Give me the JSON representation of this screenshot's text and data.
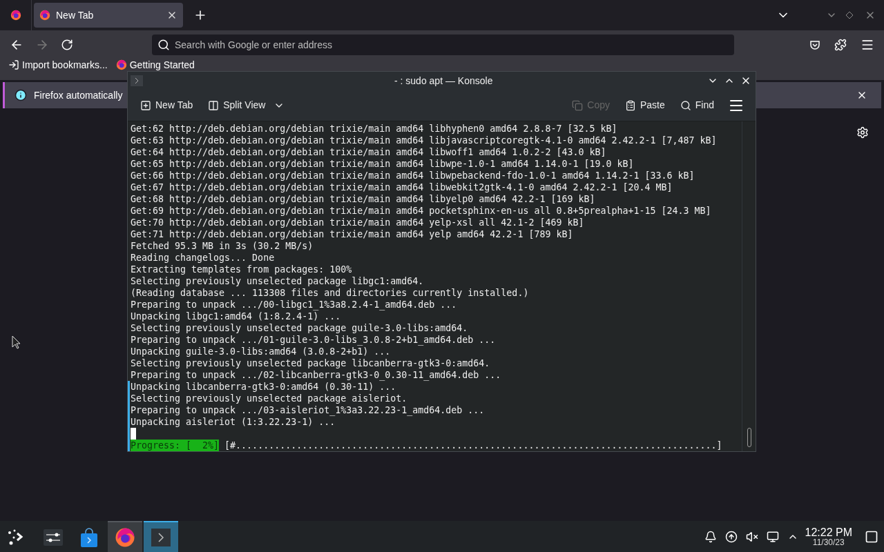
{
  "firefox": {
    "tabs": [
      {
        "title": "New Tab",
        "selected": true
      }
    ],
    "address_bar": {
      "placeholder": "Search with Google or enter address"
    },
    "forward_disabled": true,
    "bookmarks": [
      "Import bookmarks...",
      "Getting Started"
    ],
    "notification": {
      "text": "Firefox automatically"
    }
  },
  "konsole": {
    "title": "- : sudo apt — Konsole",
    "toolbar": [
      {
        "label": "New Tab",
        "kind": "new-tab",
        "disabled": false
      },
      {
        "label": "Split View",
        "kind": "split",
        "disabled": false
      }
    ],
    "actions": [
      {
        "label": "Copy",
        "kind": "copy",
        "disabled": true
      },
      {
        "label": "Paste",
        "kind": "paste",
        "disabled": false
      },
      {
        "label": "Find",
        "kind": "find",
        "disabled": false
      }
    ],
    "lines": [
      {
        "text": "Get:62 http://deb.debian.org/debian trixie/main amd64 libhyphen0 amd64 2.8.8-7 [32.5 kB]",
        "marked": false
      },
      {
        "text": "Get:63 http://deb.debian.org/debian trixie/main amd64 libjavascriptcoregtk-4.1-0 amd64 2.42.2-1 [7,487 kB]",
        "marked": false
      },
      {
        "text": "Get:64 http://deb.debian.org/debian trixie/main amd64 libwoff1 amd64 1.0.2-2 [43.0 kB]",
        "marked": false
      },
      {
        "text": "Get:65 http://deb.debian.org/debian trixie/main amd64 libwpe-1.0-1 amd64 1.14.0-1 [19.0 kB]",
        "marked": false
      },
      {
        "text": "Get:66 http://deb.debian.org/debian trixie/main amd64 libwpebackend-fdo-1.0-1 amd64 1.14.2-1 [33.6 kB]",
        "marked": false
      },
      {
        "text": "Get:67 http://deb.debian.org/debian trixie/main amd64 libwebkit2gtk-4.1-0 amd64 2.42.2-1 [20.4 MB]",
        "marked": false
      },
      {
        "text": "Get:68 http://deb.debian.org/debian trixie/main amd64 libyelp0 amd64 42.2-1 [169 kB]",
        "marked": false
      },
      {
        "text": "Get:69 http://deb.debian.org/debian trixie/main amd64 pocketsphinx-en-us all 0.8+5prealpha+1-15 [24.3 MB]",
        "marked": false
      },
      {
        "text": "Get:70 http://deb.debian.org/debian trixie/main amd64 yelp-xsl all 42.1-2 [469 kB]",
        "marked": false
      },
      {
        "text": "Get:71 http://deb.debian.org/debian trixie/main amd64 yelp amd64 42.2-1 [789 kB]",
        "marked": false
      },
      {
        "text": "Fetched 95.3 MB in 3s (30.2 MB/s)",
        "marked": false
      },
      {
        "text": "Reading changelogs... Done",
        "marked": false
      },
      {
        "text": "Extracting templates from packages: 100%",
        "marked": false
      },
      {
        "text": "Selecting previously unselected package libgc1:amd64.",
        "marked": false
      },
      {
        "text": "(Reading database ... 113308 files and directories currently installed.)",
        "marked": false
      },
      {
        "text": "Preparing to unpack .../00-libgc1_1%3a8.2.4-1_amd64.deb ...",
        "marked": false
      },
      {
        "text": "Unpacking libgc1:amd64 (1:8.2.4-1) ...",
        "marked": false
      },
      {
        "text": "Selecting previously unselected package guile-3.0-libs:amd64.",
        "marked": false
      },
      {
        "text": "Preparing to unpack .../01-guile-3.0-libs_3.0.8-2+b1_amd64.deb ...",
        "marked": false
      },
      {
        "text": "Unpacking guile-3.0-libs:amd64 (3.0.8-2+b1) ...",
        "marked": false
      },
      {
        "text": "Selecting previously unselected package libcanberra-gtk3-0:amd64.",
        "marked": false
      },
      {
        "text": "Preparing to unpack .../02-libcanberra-gtk3-0_0.30-11_amd64.deb ...",
        "marked": false
      },
      {
        "text": "Unpacking libcanberra-gtk3-0:amd64 (0.30-11) ...",
        "marked": true
      },
      {
        "text": "Selecting previously unselected package aisleriot.",
        "marked": true
      },
      {
        "text": "Preparing to unpack .../03-aisleriot_1%3a3.22.23-1_amd64.deb ...",
        "marked": true
      },
      {
        "text": "Unpacking aisleriot (1:3.22.23-1) ...",
        "marked": true
      }
    ],
    "cursor": {
      "marked": true
    },
    "progress": {
      "label": "Progress: [  2%]",
      "bar": "[#.......................................................................................]",
      "marked": true
    }
  },
  "taskbar": {
    "items": [
      {
        "kind": "settings",
        "selected": false,
        "open": false
      },
      {
        "kind": "store",
        "selected": false,
        "open": false
      },
      {
        "kind": "firefox",
        "selected": false,
        "open": true
      },
      {
        "kind": "terminal",
        "selected": true,
        "open": true
      }
    ],
    "clock": {
      "time": "12:22 PM",
      "date": "11/30/23"
    }
  }
}
